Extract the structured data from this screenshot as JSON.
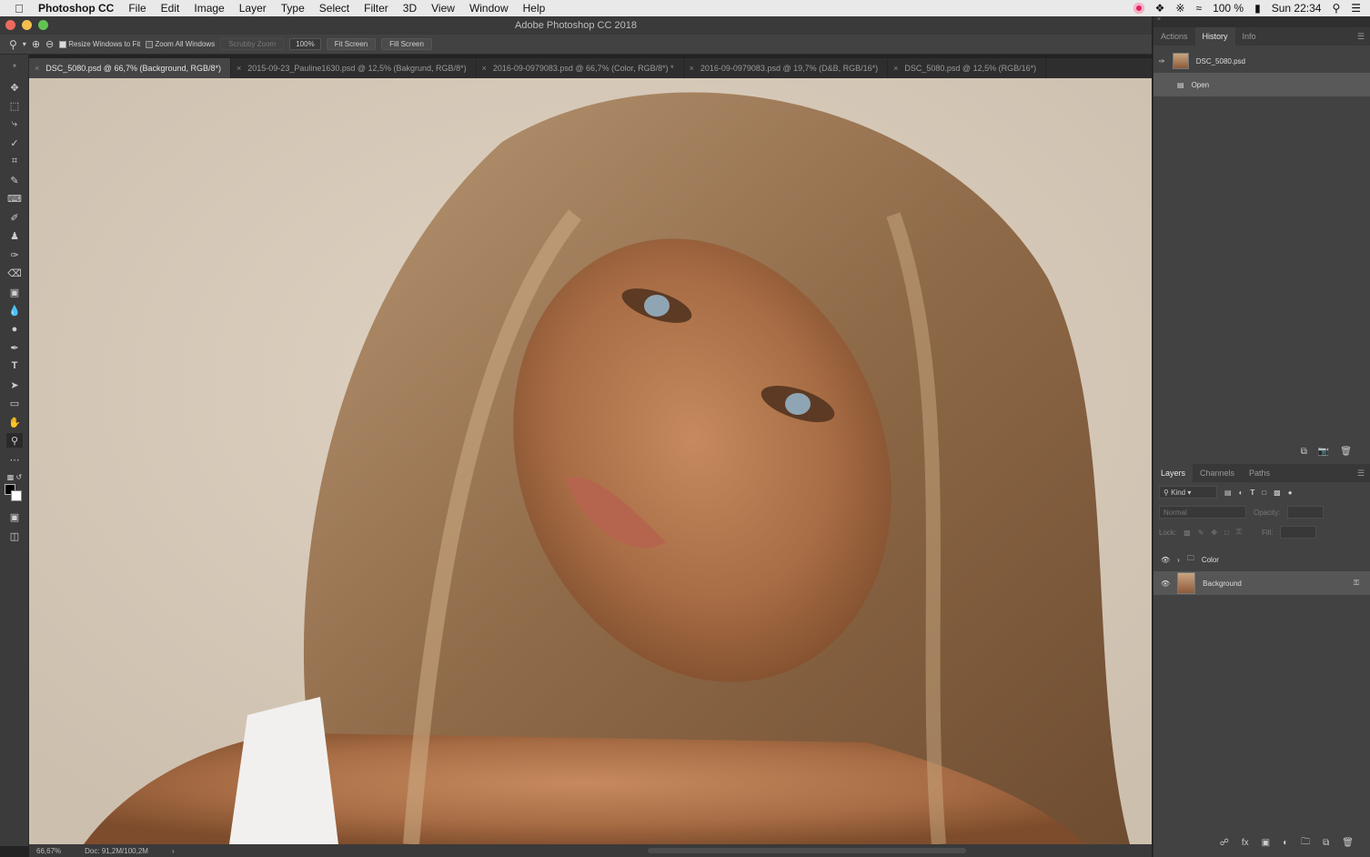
{
  "menubar": {
    "app": "Photoshop CC",
    "items": [
      "File",
      "Edit",
      "Image",
      "Layer",
      "Type",
      "Select",
      "Filter",
      "3D",
      "View",
      "Window",
      "Help"
    ],
    "battery": "100 %",
    "clock": "Sun 22:34"
  },
  "window": {
    "title": "Adobe Photoshop CC 2018"
  },
  "options": {
    "resize_windows": "Resize Windows to Fit",
    "zoom_all": "Zoom All Windows",
    "scrubby": "Scrubby Zoom",
    "zoom_value": "100%",
    "fit_screen": "Fit Screen",
    "fill_screen": "Fill Screen"
  },
  "tabs": [
    "DSC_5080.psd @ 66,7% (Background, RGB/8*)",
    "2015-09-23_Pauline1630.psd @ 12,5% (Bakgrund, RGB/8*)",
    "2016-09-0979083.psd @ 66,7% (Color, RGB/8*) *",
    "2016-09-0979083.psd @ 19,7% (D&B, RGB/16*)",
    "DSC_5080.psd @ 12,5% (RGB/16*)"
  ],
  "status": {
    "zoom": "66,67%",
    "doc": "Doc: 91,2M/100,2M"
  },
  "history_panel": {
    "tabs": [
      "Actions",
      "History",
      "Info"
    ],
    "snapshot": "DSC_5080.psd",
    "steps": [
      "Open"
    ]
  },
  "layers_panel": {
    "tabs": [
      "Layers",
      "Channels",
      "Paths"
    ],
    "filter": "Kind",
    "blend": "Normal",
    "opacity_label": "Opacity:",
    "lock_label": "Lock:",
    "fill_label": "Fill:",
    "layers": [
      {
        "name": "Color"
      },
      {
        "name": "Background"
      }
    ]
  },
  "colors": {
    "foreground": "#000000",
    "background": "#ffffff",
    "traffic_red": "#ed6a5e",
    "traffic_yellow": "#f5bf4f",
    "traffic_green": "#61c454"
  }
}
